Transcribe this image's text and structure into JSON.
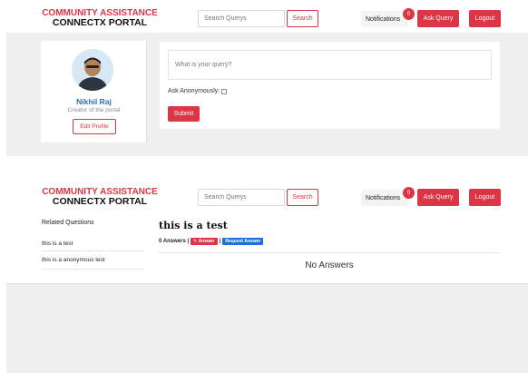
{
  "header": {
    "logo_line1": "COMMUNITY ASSISTANCE",
    "logo_line2": "CONNECTX PORTAL",
    "search_placeholder": "Search Querys",
    "search_button": "Search",
    "notifications_label": "Notifications",
    "notifications_count": "0",
    "ask_button": "Ask Query",
    "logout_button": "Logout"
  },
  "profile": {
    "name": "Nikhil Raj",
    "role": "Creator of the portal",
    "edit_button": "Edit Profile"
  },
  "query_form": {
    "placeholder": "What is your query?",
    "anonymous_label": "Ask Anonymously:",
    "submit_button": "Submit"
  },
  "related": {
    "title": "Related Questions",
    "items": [
      "this is a test",
      "this is a anonymous test"
    ]
  },
  "question": {
    "title": "this is a test",
    "answers_count": "0 Answers |",
    "answer_button": "Answer",
    "separator": "|",
    "request_button": "Request Answer",
    "empty_message": "No Answers"
  },
  "colors": {
    "accent": "#dc3545",
    "link": "#2a6ebb",
    "request": "#1f6fd6",
    "panel_bg": "#efefef"
  }
}
